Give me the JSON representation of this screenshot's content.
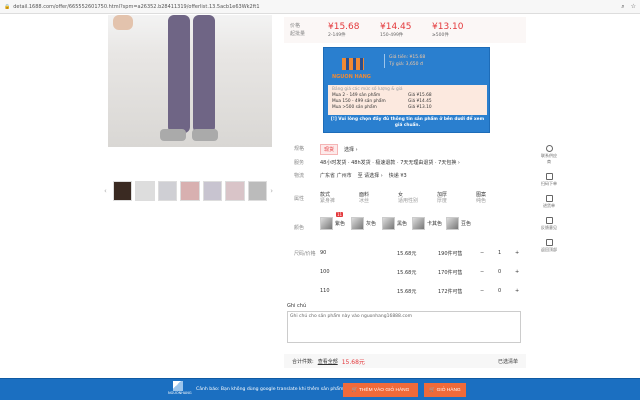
{
  "browser": {
    "url": "detail.1688.com/offer/665552601750.html?spm=a26352.b28411319/offerlist.13.5acb1e63Wk2ft1",
    "icons": [
      "zoom-icon",
      "star-icon"
    ]
  },
  "price": {
    "label1": "价格",
    "label2": "起批量",
    "tiers": [
      {
        "price": "¥15.68",
        "qty": "2-149件"
      },
      {
        "price": "¥14.45",
        "qty": "150-499件"
      },
      {
        "price": "¥13.10",
        "qty": "≥500件"
      }
    ]
  },
  "banner": {
    "brand": "NGUON HANG",
    "header1": "Giá tiền: ¥15.68",
    "header2": "Tỷ giá: 3,650 đ",
    "table_title": "Bảng giá các mức số lượng & giá",
    "rows": [
      {
        "qty": "Mua 2 - 149 sản phẩm",
        "price": "Giá ¥15.68"
      },
      {
        "qty": "Mua 150 - 499 sản phẩm",
        "price": "Giá ¥14.45"
      },
      {
        "qty": "Mua >500 sản phẩm",
        "price": "Giá ¥13.10"
      }
    ],
    "note": "[!] Vui lòng chọn đầy đủ thông tin sản phẩm ở bên dưới để xem giá chuẩn."
  },
  "spec": {
    "label": "规格",
    "selected": "现货",
    "more": "选择 ›"
  },
  "shipping": {
    "label": "服务",
    "text": "48小时发货 · 48h发货 · 极速退款 · 7天无理由退货 · 7天包换 ›"
  },
  "logistics": {
    "label": "物流",
    "from": "广东省 广州市",
    "to": "至 请选择 ›",
    "fee": "快递 ¥3"
  },
  "attrs": {
    "label": "属性",
    "items": [
      {
        "k": "款式",
        "v": "紧身裤"
      },
      {
        "k": "面料",
        "v": "冰丝"
      },
      {
        "k": "女",
        "v": "适用性别"
      },
      {
        "k": "加厚",
        "v": "厚度"
      },
      {
        "k": "图案",
        "v": "纯色"
      }
    ]
  },
  "colors": {
    "label": "颜色",
    "badge": "11",
    "items": [
      "紫色",
      "灰色",
      "黑色",
      "卡其色",
      "豆色"
    ]
  },
  "sizes": {
    "label": "尺码/价格",
    "rows": [
      {
        "size": "90",
        "price": "15.68元",
        "stock": "190件可售",
        "qty": "1"
      },
      {
        "size": "100",
        "price": "15.68元",
        "stock": "170件可售",
        "qty": "0"
      },
      {
        "size": "110",
        "price": "15.68元",
        "stock": "172件可售",
        "qty": "0"
      }
    ],
    "minus": "−",
    "plus": "+"
  },
  "remark": {
    "label": "Ghi chú",
    "value": "Ghi chú cho sản phẩm này vào nguonhang16888.com"
  },
  "total": {
    "label": "合计件数:",
    "link": "查看全部",
    "amount": "15.68元",
    "cart": "已选清单"
  },
  "sidebar": [
    "联系供应商",
    "扫码下单",
    "进货单",
    "反馈意见",
    "返回顶部"
  ],
  "bottom": {
    "brand": "NGUONHANG",
    "warning": "Cảnh báo: Bạn không dùng google translate khi thêm sản phẩm!",
    "add_cart": "THÊM VÀO GIỎ HÀNG",
    "cart": "GIỎ HÀNG"
  },
  "colors_theme": {
    "accent": "#e4393c",
    "banner": "#2a7fcf",
    "button": "#ef6a3a",
    "bar": "#1b6fc1"
  }
}
